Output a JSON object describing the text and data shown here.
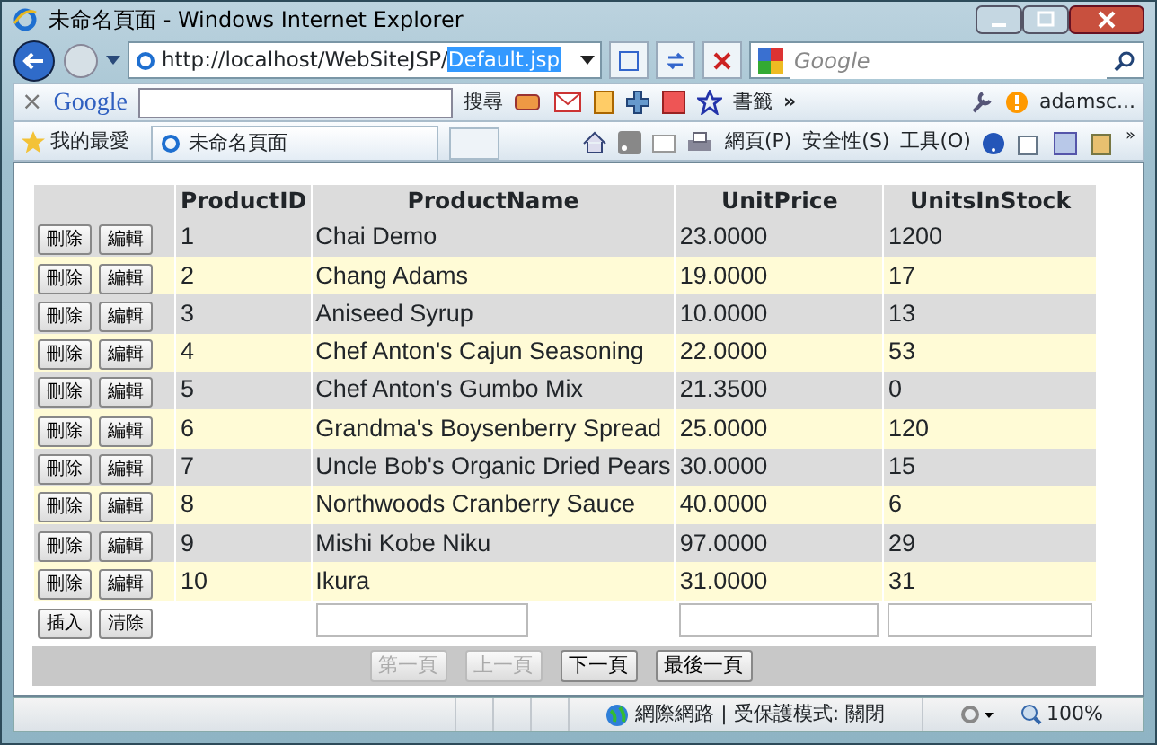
{
  "window": {
    "title": "未命名頁面 - Windows Internet Explorer"
  },
  "address_bar": {
    "url": "http://localhost/WebSiteJSP/",
    "url_selected": "Default.jsp"
  },
  "search": {
    "placeholder": "Google"
  },
  "google_toolbar": {
    "close": "×",
    "logo": "Google",
    "search_label": "搜尋",
    "bookmarks_label": "書籤",
    "more": "»",
    "account": "adamsc..."
  },
  "favorites": {
    "label": "我的最愛"
  },
  "tab": {
    "title": "未命名頁面"
  },
  "command_bar": {
    "more": "»",
    "menus": [
      "網頁(P)",
      "安全性(S)",
      "工具(O)"
    ]
  },
  "table": {
    "columns": [
      "ProductID",
      "ProductName",
      "UnitPrice",
      "UnitsInStock"
    ],
    "rows": [
      {
        "buttons": [
          "刪除",
          "編輯"
        ],
        "cells": [
          "1",
          "Chai Demo",
          "23.0000",
          "1200"
        ]
      },
      {
        "buttons": [
          "刪除",
          "編輯"
        ],
        "cells": [
          "2",
          "Chang Adams",
          "19.0000",
          "17"
        ]
      },
      {
        "buttons": [
          "刪除",
          "編輯"
        ],
        "cells": [
          "3",
          "Aniseed Syrup",
          "10.0000",
          "13"
        ]
      },
      {
        "buttons": [
          "刪除",
          "編輯"
        ],
        "cells": [
          "4",
          "Chef Anton's Cajun Seasoning",
          "22.0000",
          "53"
        ]
      },
      {
        "buttons": [
          "刪除",
          "編輯"
        ],
        "cells": [
          "5",
          "Chef Anton's Gumbo Mix",
          "21.3500",
          "0"
        ]
      },
      {
        "buttons": [
          "刪除",
          "編輯"
        ],
        "cells": [
          "6",
          "Grandma's Boysenberry Spread",
          "25.0000",
          "120"
        ]
      },
      {
        "buttons": [
          "刪除",
          "編輯"
        ],
        "cells": [
          "7",
          "Uncle Bob's Organic Dried Pears",
          "30.0000",
          "15"
        ]
      },
      {
        "buttons": [
          "刪除",
          "編輯"
        ],
        "cells": [
          "8",
          "Northwoods Cranberry Sauce",
          "40.0000",
          "6"
        ]
      },
      {
        "buttons": [
          "刪除",
          "編輯"
        ],
        "cells": [
          "9",
          "Mishi Kobe Niku",
          "97.0000",
          "29"
        ]
      },
      {
        "buttons": [
          "刪除",
          "編輯"
        ],
        "cells": [
          "10",
          "Ikura",
          "31.0000",
          "31"
        ]
      }
    ],
    "insert_row": {
      "buttons": [
        "插入",
        "清除"
      ]
    }
  },
  "pager": [
    {
      "label": "第一頁",
      "disabled": true
    },
    {
      "label": "上一頁",
      "disabled": true
    },
    {
      "label": "下一頁",
      "disabled": false
    },
    {
      "label": "最後一頁",
      "disabled": false
    }
  ],
  "status_bar": {
    "zone": "網際網路 | 受保護模式: 關閉",
    "zoom": "100%"
  }
}
